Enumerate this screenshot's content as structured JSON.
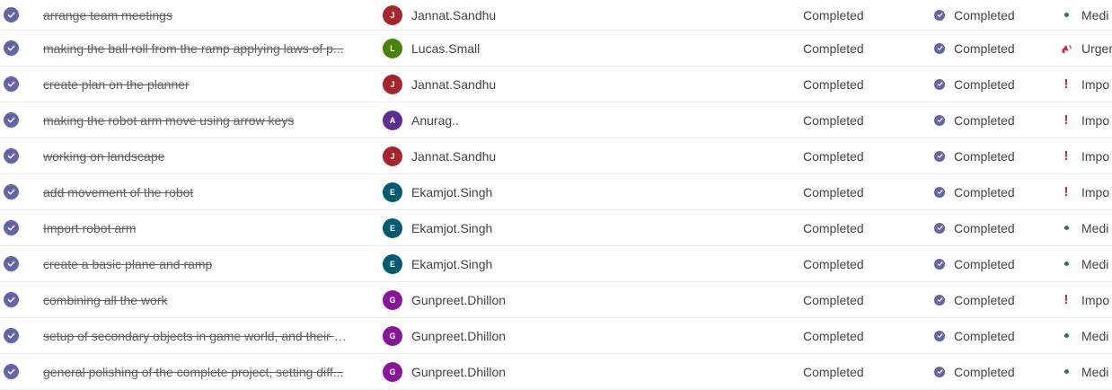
{
  "colors": {
    "accent": "#6264a7",
    "important": "#c4314b",
    "urgent": "#c4314b",
    "medium": "#237b4b"
  },
  "tasks": [
    {
      "title": "arrange team meetings",
      "assignee": "Jannat.Sandhu",
      "initial": "J",
      "avatar_color": "#a4262c",
      "progress": "Completed",
      "bucket": "Completed",
      "priority": "Medi",
      "priority_icon": "dot-icon"
    },
    {
      "title": "making the ball roll from the ramp applying laws of p...",
      "assignee": "Lucas.Small",
      "initial": "L",
      "avatar_color": "#498205",
      "progress": "Completed",
      "bucket": "Completed",
      "priority": "Urger",
      "priority_icon": "urgent-icon"
    },
    {
      "title": "create plan on the planner",
      "assignee": "Jannat.Sandhu",
      "initial": "J",
      "avatar_color": "#a4262c",
      "progress": "Completed",
      "bucket": "Completed",
      "priority": "Impo",
      "priority_icon": "important-icon"
    },
    {
      "title": "making the robot arm move using arrow keys",
      "assignee": "Anurag..",
      "initial": "A",
      "avatar_color": "#5c2e91",
      "progress": "Completed",
      "bucket": "Completed",
      "priority": "Impo",
      "priority_icon": "important-icon"
    },
    {
      "title": "working on landscape",
      "assignee": "Jannat.Sandhu",
      "initial": "J",
      "avatar_color": "#a4262c",
      "progress": "Completed",
      "bucket": "Completed",
      "priority": "Impo",
      "priority_icon": "important-icon"
    },
    {
      "title": "add movement of the robot",
      "assignee": "Ekamjot.Singh",
      "initial": "E",
      "avatar_color": "#005b70",
      "progress": "Completed",
      "bucket": "Completed",
      "priority": "Impo",
      "priority_icon": "important-icon"
    },
    {
      "title": "Import robot arm",
      "assignee": "Ekamjot.Singh",
      "initial": "E",
      "avatar_color": "#005b70",
      "progress": "Completed",
      "bucket": "Completed",
      "priority": "Medi",
      "priority_icon": "dot-icon"
    },
    {
      "title": "create a basic plane and ramp",
      "assignee": "Ekamjot.Singh",
      "initial": "E",
      "avatar_color": "#005b70",
      "progress": "Completed",
      "bucket": "Completed",
      "priority": "Medi",
      "priority_icon": "dot-icon"
    },
    {
      "title": "combining all the work",
      "assignee": "Gunpreet.Dhillon",
      "initial": "G",
      "avatar_color": "#881798",
      "progress": "Completed",
      "bucket": "Completed",
      "priority": "Impo",
      "priority_icon": "important-icon"
    },
    {
      "title": "setup of secondary objects in game world, and their p...",
      "assignee": "Gunpreet.Dhillon",
      "initial": "G",
      "avatar_color": "#881798",
      "progress": "Completed",
      "bucket": "Completed",
      "priority": "Medi",
      "priority_icon": "dot-icon"
    },
    {
      "title": "general polishing of the complete project, setting diff...",
      "assignee": "Gunpreet.Dhillon",
      "initial": "G",
      "avatar_color": "#881798",
      "progress": "Completed",
      "bucket": "Completed",
      "priority": "Medi",
      "priority_icon": "dot-icon"
    }
  ]
}
